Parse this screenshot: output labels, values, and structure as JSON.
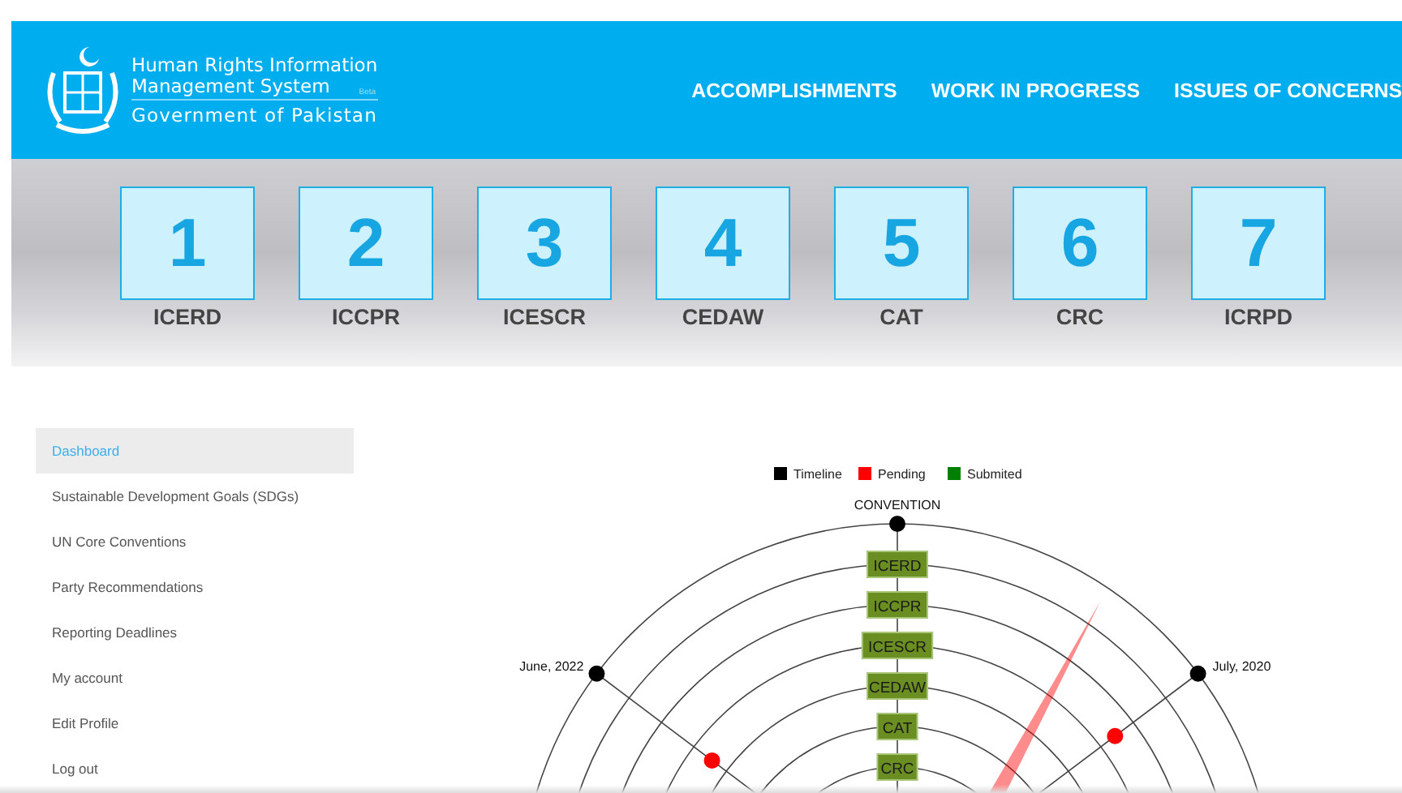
{
  "header": {
    "title_line_1": "Human Rights Information",
    "title_line_2": "Management System",
    "badge": "Beta",
    "subtitle": "Government of Pakistan",
    "nav": [
      {
        "label": "ACCOMPLISHMENTS"
      },
      {
        "label": "WORK IN PROGRESS"
      },
      {
        "label": "ISSUES OF CONCERNS"
      }
    ]
  },
  "conventions": [
    {
      "number": "1",
      "label": "ICERD"
    },
    {
      "number": "2",
      "label": "ICCPR"
    },
    {
      "number": "3",
      "label": "ICESCR"
    },
    {
      "number": "4",
      "label": "CEDAW"
    },
    {
      "number": "5",
      "label": "CAT"
    },
    {
      "number": "6",
      "label": "CRC"
    },
    {
      "number": "7",
      "label": "ICRPD"
    }
  ],
  "sidebar": {
    "items": [
      {
        "label": "Dashboard",
        "selected": true
      },
      {
        "label": "Sustainable Development Goals (SDGs)",
        "selected": false
      },
      {
        "label": "UN Core Conventions",
        "selected": false
      },
      {
        "label": "Party Recommendations",
        "selected": false
      },
      {
        "label": "Reporting Deadlines",
        "selected": false
      },
      {
        "label": "My account",
        "selected": false
      },
      {
        "label": "Edit Profile",
        "selected": false
      },
      {
        "label": "Log out",
        "selected": false
      }
    ]
  },
  "radial_chart": {
    "legend": [
      {
        "label": "Timeline",
        "color": "#000000"
      },
      {
        "label": "Pending",
        "color": "#ff0000"
      },
      {
        "label": "Submited",
        "color": "#008000"
      }
    ],
    "axes": [
      {
        "label": "CONVENTION",
        "kind": "top"
      },
      {
        "label": "June, 2022",
        "kind": "left"
      },
      {
        "label": "July, 2020",
        "kind": "right"
      }
    ],
    "rings": [
      "ICERD",
      "ICCPR",
      "ICESCR",
      "CEDAW",
      "CAT",
      "CRC"
    ]
  }
}
